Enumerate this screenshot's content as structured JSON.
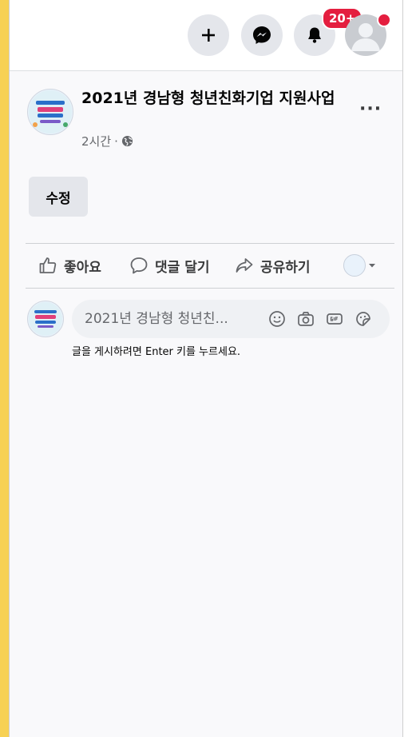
{
  "topbar": {
    "notification_count": "20+"
  },
  "post": {
    "title": "2021년 경남형 청년친화기업 지원사업",
    "time": "2시간",
    "meta_separator": "·",
    "more": "···",
    "edit_label": "수정"
  },
  "actions": {
    "like": "좋아요",
    "comment": "댓글 달기",
    "share": "공유하기"
  },
  "comment": {
    "placeholder": "2021년 경남형 청년친...",
    "hint": "글을 게시하려면 Enter 키를 누르세요."
  },
  "colors": {
    "accent_bar": "#f7d154",
    "badge": "#e41e3f",
    "button_bg": "#e4e6eb"
  }
}
